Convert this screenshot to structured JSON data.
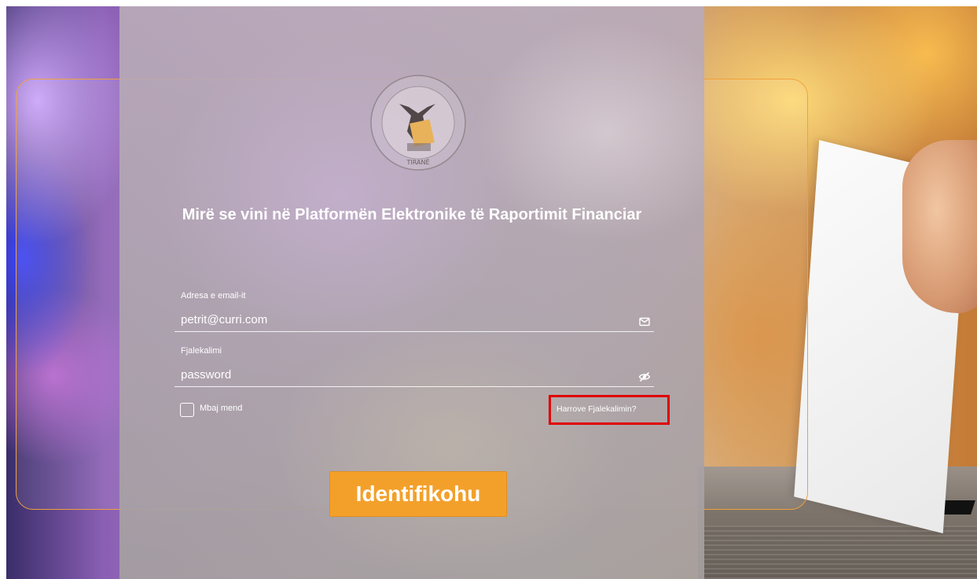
{
  "page": {
    "title": "Mirë se vini në Platformën Elektronike të Raportimit Financiar"
  },
  "logo": {
    "bottom_text": "TIRANË"
  },
  "form": {
    "email_label": "Adresa e email-it",
    "email_value": "petrit@curri.com",
    "email_icon": "mail-icon",
    "password_label": "Fjalekalimi",
    "password_value": "password",
    "password_icon": "eye-off-icon",
    "remember_label": "Mbaj mend",
    "forgot_label": "Harrove Fjalekalimin?",
    "submit_label": "Identifikohu"
  },
  "colors": {
    "accent": "#f3a02b",
    "highlight_border": "#e00000",
    "frame_border": "#f0a13a"
  }
}
